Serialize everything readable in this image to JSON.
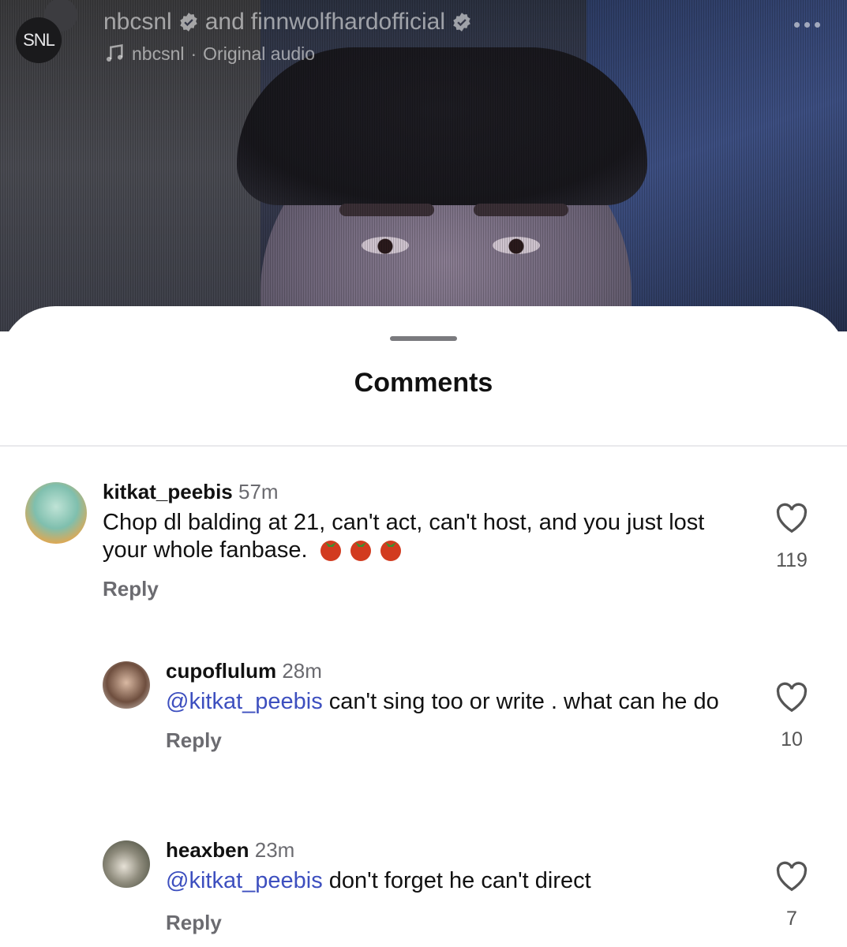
{
  "header": {
    "account_1": "nbcsnl",
    "joiner": "and",
    "account_2": "finnwolfhardofficial",
    "audio_owner": "nbcsnl",
    "audio_separator": "·",
    "audio_label": "Original audio",
    "avatar_text": "SNL"
  },
  "sheet": {
    "title": "Comments"
  },
  "comments": [
    {
      "username": "kitkat_peebis",
      "time": "57m",
      "text": "Chop dl balding at 21, can't act, can't host, and you just lost your whole fanbase.",
      "emoji": "tomato",
      "reply_label": "Reply",
      "likes": "119"
    },
    {
      "username": "cupoflulum",
      "time": "28m",
      "mention": "@kitkat_peebis",
      "text": " can't sing too or write . what can he do",
      "reply_label": "Reply",
      "likes": "10"
    },
    {
      "username": "heaxben",
      "time": "23m",
      "mention": "@kitkat_peebis",
      "text": " don't forget he can't direct",
      "reply_label": "Reply",
      "likes": "7"
    }
  ],
  "icons": {
    "verified": "verified-badge-icon",
    "music": "music-note-icon",
    "more": "more-options-icon",
    "like": "heart-outline-icon"
  },
  "colors": {
    "mention": "#3d4fbf",
    "muted": "#6b6b70"
  }
}
